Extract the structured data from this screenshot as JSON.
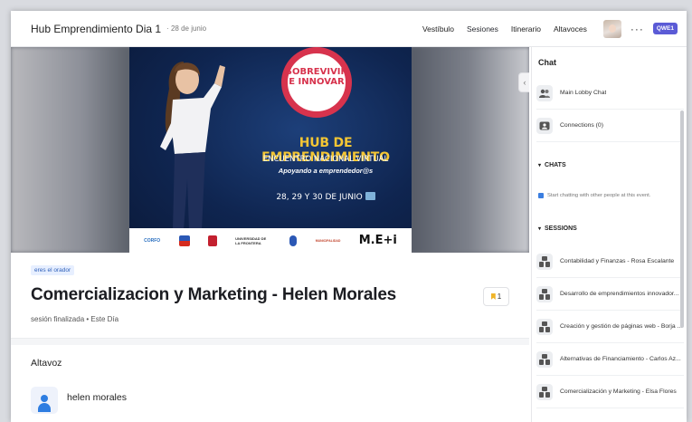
{
  "header": {
    "event_title": "Hub Emprendimiento Dia 1",
    "date": "· 28 de junio",
    "nav": [
      "Vestíbulo",
      "Sesiones",
      "Itinerario",
      "Altavoces"
    ],
    "more": "···",
    "brand_badge": "QWE1"
  },
  "banner": {
    "circle_text": "SOBREVIVIR\nE INNOVAR",
    "headline": "HUB DE EMPRENDIMIENTO",
    "subheadline": "ENCUENTRO NACIONAL VIRTUAL",
    "tagline": "Apoyando a emprendedor@s",
    "dates": "28, 29 Y 30 DE JUNIO",
    "logos": [
      "CORFO",
      "UNIVERSIDAD DE LA FRONTERA",
      "MUNICIPALIDAD",
      "M.E+i"
    ]
  },
  "session": {
    "tag": "eres el orador",
    "title": "Comercializacion y Marketing - Helen Morales",
    "meta": "sesión finalizada • Este Día",
    "bookmark_count": "1",
    "speakers_heading": "Altavoz",
    "speaker_name": "helen morales"
  },
  "sidebar": {
    "heading": "Chat",
    "lobby": "Main Lobby Chat",
    "connections": "Connections (0)",
    "chats_section": "CHATS",
    "chats_note": "Start chatting with other people at this event.",
    "sessions_section": "SESSIONS",
    "sessions": [
      "Contabilidad y Finanzas - Rosa Escalante",
      "Desarrollo de emprendimientos innovador...",
      "Creación y gestión de páginas web - Borja ...",
      "Alternativas de Financiamiento - Carlos Az...",
      "Comercialización y Marketing - Elsa Flores"
    ]
  },
  "colors": {
    "accent": "#5b5bd6",
    "banner_yellow": "#f4c634",
    "banner_red": "#d7334d",
    "link_blue": "#2d5fb8"
  }
}
